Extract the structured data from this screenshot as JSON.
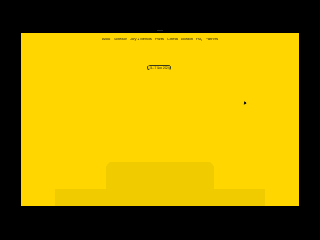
{
  "nav": {
    "items": [
      {
        "label": "About"
      },
      {
        "label": "Schedule"
      },
      {
        "label": "Jury & Mentors"
      },
      {
        "label": "Prizes"
      },
      {
        "label": "Criteria"
      },
      {
        "label": "Location"
      },
      {
        "label": "FAQ"
      },
      {
        "label": "Partners"
      }
    ]
  },
  "hero": {
    "date_label": "15-17 Nov 2024"
  },
  "colors": {
    "background": "#FFD600",
    "shape": "#EFCB00",
    "frame": "#000000",
    "text": "#1a1a1a"
  }
}
